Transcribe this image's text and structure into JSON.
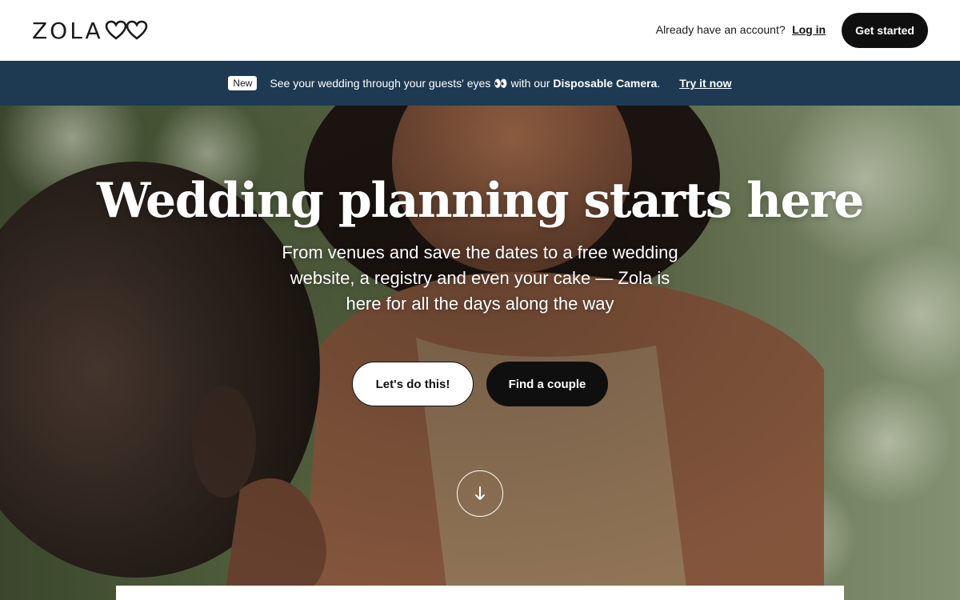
{
  "header": {
    "logo_text": "ZOLA",
    "account_prompt": "Already have an account?",
    "login_label": "Log in",
    "get_started_label": "Get started"
  },
  "banner": {
    "badge": "New",
    "text_before": "See your wedding through your guests' eyes 👀 with our ",
    "text_bold": "Disposable Camera",
    "text_after": ".",
    "cta_label": "Try it now",
    "background_color": "#1e3a52"
  },
  "hero": {
    "title": "Wedding planning starts here",
    "subtitle": "From venues and save the dates to a free wedding website, a registry and even your cake — Zola is here for all the days along the way",
    "primary_button_label": "Let's do this!",
    "secondary_button_label": "Find a couple",
    "scroll_icon": "arrow-down-icon"
  },
  "colors": {
    "dark_button": "#0f0f0f",
    "banner": "#1e3a52",
    "white": "#ffffff"
  }
}
